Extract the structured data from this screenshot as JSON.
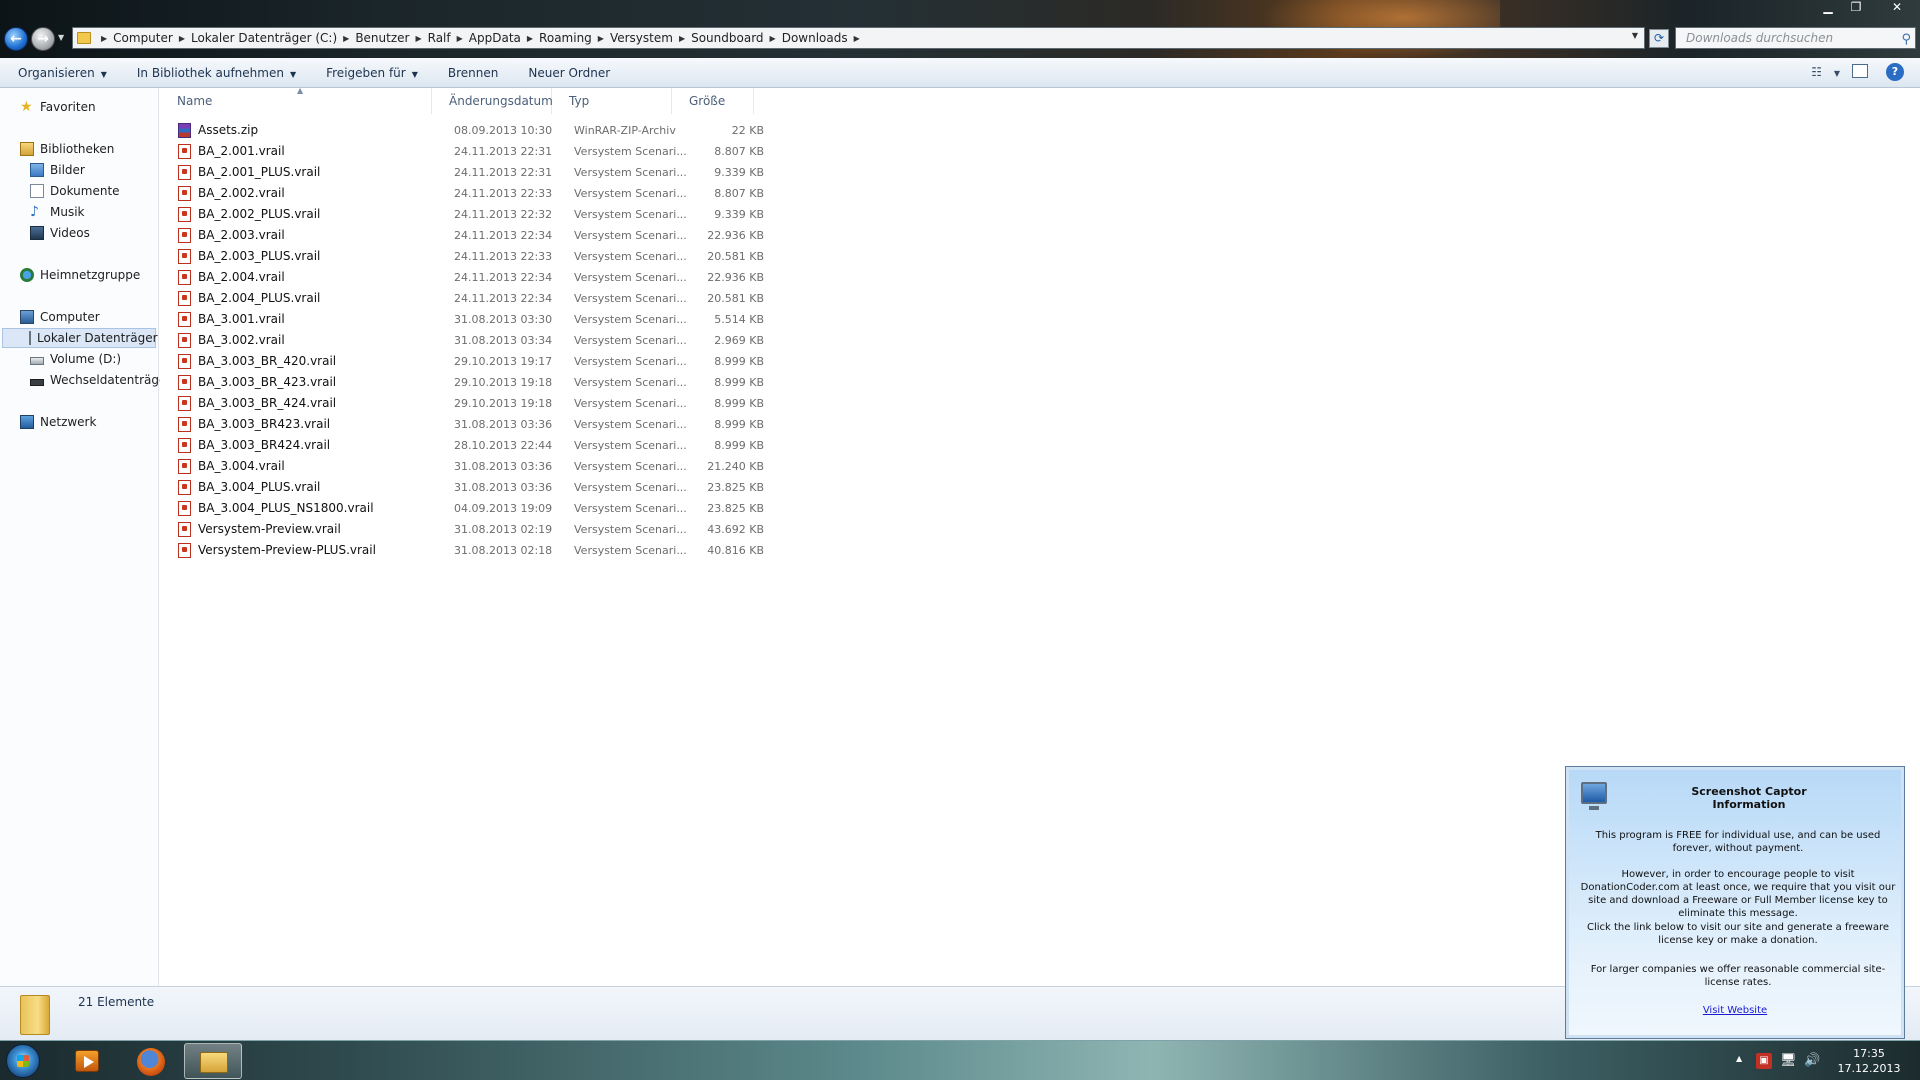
{
  "window": {
    "controls": {
      "minimize": "▁",
      "maximize": "❐",
      "close": "✕"
    }
  },
  "address": {
    "breadcrumbs": [
      "Computer",
      "Lokaler Datenträger (C:)",
      "Benutzer",
      "Ralf",
      "AppData",
      "Roaming",
      "Versystem",
      "Soundboard",
      "Downloads"
    ],
    "search_placeholder": "Downloads durchsuchen"
  },
  "commandbar": {
    "organize": "Organisieren",
    "library": "In Bibliothek aufnehmen",
    "share": "Freigeben für",
    "burn": "Brennen",
    "new_folder": "Neuer Ordner",
    "help": "?"
  },
  "navpane": {
    "favorites": "Favoriten",
    "libraries": "Bibliotheken",
    "pictures": "Bilder",
    "documents": "Dokumente",
    "music": "Musik",
    "videos": "Videos",
    "homegroup": "Heimnetzgruppe",
    "computer": "Computer",
    "local_disk": "Lokaler Datenträger",
    "volume_d": "Volume (D:)",
    "removable": "Wechseldatenträger",
    "network": "Netzwerk"
  },
  "columns": {
    "name": "Name",
    "date": "Änderungsdatum",
    "type": "Typ",
    "size": "Größe"
  },
  "files": [
    {
      "name": "Assets.zip",
      "date": "08.09.2013 10:30",
      "type": "WinRAR-ZIP-Archiv",
      "size": "22 KB",
      "kind": "zip"
    },
    {
      "name": "BA_2.001.vrail",
      "date": "24.11.2013 22:31",
      "type": "Versystem Scenari...",
      "size": "8.807 KB",
      "kind": "vrail"
    },
    {
      "name": "BA_2.001_PLUS.vrail",
      "date": "24.11.2013 22:31",
      "type": "Versystem Scenari...",
      "size": "9.339 KB",
      "kind": "vrail"
    },
    {
      "name": "BA_2.002.vrail",
      "date": "24.11.2013 22:33",
      "type": "Versystem Scenari...",
      "size": "8.807 KB",
      "kind": "vrail"
    },
    {
      "name": "BA_2.002_PLUS.vrail",
      "date": "24.11.2013 22:32",
      "type": "Versystem Scenari...",
      "size": "9.339 KB",
      "kind": "vrail"
    },
    {
      "name": "BA_2.003.vrail",
      "date": "24.11.2013 22:34",
      "type": "Versystem Scenari...",
      "size": "22.936 KB",
      "kind": "vrail"
    },
    {
      "name": "BA_2.003_PLUS.vrail",
      "date": "24.11.2013 22:33",
      "type": "Versystem Scenari...",
      "size": "20.581 KB",
      "kind": "vrail"
    },
    {
      "name": "BA_2.004.vrail",
      "date": "24.11.2013 22:34",
      "type": "Versystem Scenari...",
      "size": "22.936 KB",
      "kind": "vrail"
    },
    {
      "name": "BA_2.004_PLUS.vrail",
      "date": "24.11.2013 22:34",
      "type": "Versystem Scenari...",
      "size": "20.581 KB",
      "kind": "vrail"
    },
    {
      "name": "BA_3.001.vrail",
      "date": "31.08.2013 03:30",
      "type": "Versystem Scenari...",
      "size": "5.514 KB",
      "kind": "vrail"
    },
    {
      "name": "BA_3.002.vrail",
      "date": "31.08.2013 03:34",
      "type": "Versystem Scenari...",
      "size": "2.969 KB",
      "kind": "vrail"
    },
    {
      "name": "BA_3.003_BR_420.vrail",
      "date": "29.10.2013 19:17",
      "type": "Versystem Scenari...",
      "size": "8.999 KB",
      "kind": "vrail"
    },
    {
      "name": "BA_3.003_BR_423.vrail",
      "date": "29.10.2013 19:18",
      "type": "Versystem Scenari...",
      "size": "8.999 KB",
      "kind": "vrail"
    },
    {
      "name": "BA_3.003_BR_424.vrail",
      "date": "29.10.2013 19:18",
      "type": "Versystem Scenari...",
      "size": "8.999 KB",
      "kind": "vrail"
    },
    {
      "name": "BA_3.003_BR423.vrail",
      "date": "31.08.2013 03:36",
      "type": "Versystem Scenari...",
      "size": "8.999 KB",
      "kind": "vrail"
    },
    {
      "name": "BA_3.003_BR424.vrail",
      "date": "28.10.2013 22:44",
      "type": "Versystem Scenari...",
      "size": "8.999 KB",
      "kind": "vrail"
    },
    {
      "name": "BA_3.004.vrail",
      "date": "31.08.2013 03:36",
      "type": "Versystem Scenari...",
      "size": "21.240 KB",
      "kind": "vrail"
    },
    {
      "name": "BA_3.004_PLUS.vrail",
      "date": "31.08.2013 03:36",
      "type": "Versystem Scenari...",
      "size": "23.825 KB",
      "kind": "vrail"
    },
    {
      "name": "BA_3.004_PLUS_NS1800.vrail",
      "date": "04.09.2013 19:09",
      "type": "Versystem Scenari...",
      "size": "23.825 KB",
      "kind": "vrail"
    },
    {
      "name": "Versystem-Preview.vrail",
      "date": "31.08.2013 02:19",
      "type": "Versystem Scenari...",
      "size": "43.692 KB",
      "kind": "vrail"
    },
    {
      "name": "Versystem-Preview-PLUS.vrail",
      "date": "31.08.2013 02:18",
      "type": "Versystem Scenari...",
      "size": "40.816 KB",
      "kind": "vrail"
    }
  ],
  "details": {
    "item_count": "21 Elemente"
  },
  "taskbar": {
    "time": "17:35",
    "date": "17.12.2013"
  },
  "popup": {
    "title_line1": "Screenshot Captor",
    "title_line2": "Information",
    "p1": "This program is FREE for individual use, and can be used forever, without payment.",
    "p2": "However, in order to encourage people to visit DonationCoder.com at least once, we require that you visit our site and download a Freeware or Full Member license key to eliminate this message.",
    "p3": "Click the link below to visit our site and generate a freeware license key or make a donation.",
    "p4": "For larger companies we offer reasonable commercial site-license rates.",
    "link": "Visit Website"
  }
}
